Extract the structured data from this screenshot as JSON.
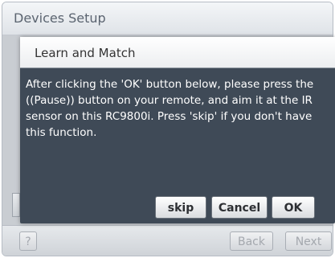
{
  "window": {
    "title": "Devices Setup"
  },
  "footer": {
    "help_label": "?",
    "back_label": "Back",
    "next_label": "Next"
  },
  "dialog": {
    "title": "Learn and Match",
    "message": "After clicking the 'OK' button below, please press the ((Pause)) button on your remote, and aim it at the IR sensor on this RC9800i. Press 'skip' if you don't have this function.",
    "buttons": {
      "skip": "skip",
      "cancel": "Cancel",
      "ok": "OK"
    }
  }
}
